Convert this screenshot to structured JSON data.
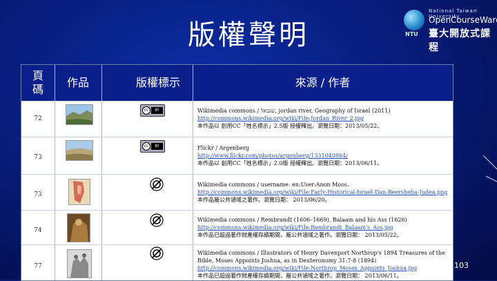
{
  "title": "版權聲明",
  "logo": {
    "line1": "National Taiwan University",
    "line2": "OpenCourseWare",
    "line3": "臺大開放式課程",
    "ntu": "NTU"
  },
  "table": {
    "headers": [
      "頁碼",
      "作品",
      "版權標示",
      "來源 / 作者"
    ],
    "rows": [
      {
        "page": "72",
        "license": "cc-by",
        "source": [
          "Wikimedia commons / שגבאל, jordan river, Geography of Israel (2011)",
          "http://commons.wikimedia.org/wiki/File:Jordan_River_2.jpg",
          "本作品以 創用CC「姓名標示」2.5版 授權釋出。瀏覽日期：2013/05/22。"
        ]
      },
      {
        "page": "73",
        "license": "cc-by",
        "source": [
          "Flickr / Argenberg",
          "http://www.flickr.com/photos/argenberg/1331040864/",
          "本作品以 創用CC「姓名標示」2.0版 授權釋出。瀏覽日期：2013/06/11。"
        ]
      },
      {
        "page": "73",
        "license": "public-domain",
        "source": [
          "Wikimedia commons / username: en:User:Anon Moos.",
          "http://commons.wikimedia.org/wiki/File:Early-Historical-Israel-Dan-Beersheba-Judea.png",
          "本作品屬公共領域之著作。瀏覽日期： 2013/06/20。"
        ]
      },
      {
        "page": "74",
        "license": "public-domain",
        "source": [
          "Wikimedia commons / Rembrandt (1606–1669), Balaam and his Ass (1626)",
          "http://commons.wikimedia.org/wiki/File:Rembrandt_Balaam's_Ass.jpg",
          "本作品已超過著作財產權存續期間，屬公共領域之著作。瀏覽日期： 2013/05/22。"
        ]
      },
      {
        "page": "77",
        "license": "public-domain",
        "source": [
          "Wikimedia commons / Illustrators of Henry Davenport Northrop's 1894 Treasures of the",
          "Bible, Moses Appoints Joshua, as in Deuteronomy 31:7-8 (1894)",
          "http://commons.wikimedia.org/wiki/File:Northrop_Moses_Appoints_Joshua.jpg",
          "本作品已超過著作財產權存續期間，屬公共領域之著作。瀏覽日期： 2013/06/11。"
        ]
      }
    ]
  },
  "page_number": "103",
  "colors": {
    "background": "#071a75",
    "header": "#0a1f8a",
    "link": "#2b4fc2"
  },
  "icons": [
    "cc-by-icon",
    "public-domain-icon"
  ]
}
